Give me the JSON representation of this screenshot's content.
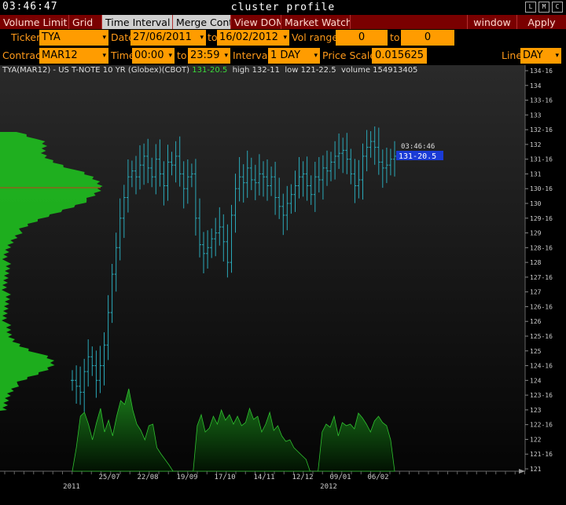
{
  "window": {
    "clock": "03:46:47",
    "title": "cluster profile",
    "buttons": [
      "L",
      "M",
      "C"
    ]
  },
  "menu": {
    "items": [
      "Volume Limit",
      "Grid",
      "Time Interval",
      "Merge Contr",
      "View DOM",
      "Market Watch"
    ],
    "right": [
      "window",
      "Apply"
    ]
  },
  "controls": {
    "ticker_label": "Ticker",
    "ticker": "TYA",
    "date_label": "Date",
    "date_from": "27/06/2011",
    "date_to_label": "to",
    "date_to": "16/02/2012",
    "vol_range_label": "Vol range",
    "vol_from": "0",
    "vol_to_label": "to",
    "vol_to": "0",
    "contract_label": "Contract",
    "contract": "MAR12",
    "time_label": "Time",
    "time_from": "00:00",
    "time_to_label": "to",
    "time_to": "23:59",
    "interval_label": "Interval",
    "interval": "1 DAY",
    "price_scale_label": "Price Scale",
    "price_scale": "0.015625",
    "line_label": "Line",
    "line": "DAY"
  },
  "chart_header": {
    "instrument": "TYA(MAR12) - US T-NOTE 10 YR (Globex)(CBOT)",
    "last": "131-20.5",
    "high": "high 132-11",
    "low": "low 121-22.5",
    "volume": "volume 154913405"
  },
  "overlay": {
    "time": "03:46:46",
    "price": "131-20.5"
  },
  "colors": {
    "candles": "#2aa8b8",
    "profile": "#1fbf1f",
    "volume": "#0c5a0c",
    "menu_bg": "#7a0000",
    "field_bg": "#ff9c00",
    "price_tag": "#1a3bd6"
  },
  "chart_data": {
    "type": "bar",
    "x_ticks": [
      "25/07",
      "22/08",
      "19/09",
      "17/10",
      "14/11",
      "12/12",
      "09/01",
      "06/02"
    ],
    "x_years": [
      "2011",
      "2012"
    ],
    "y_ticks": [
      "134-16",
      "134",
      "133-16",
      "133",
      "132-16",
      "132",
      "131-16",
      "131",
      "130-16",
      "130",
      "129-16",
      "129",
      "128-16",
      "128",
      "127-16",
      "127",
      "126-16",
      "126",
      "125-16",
      "125",
      "124-16",
      "124",
      "123-16",
      "123",
      "122-16",
      "122",
      "121-16",
      "121"
    ],
    "ylim": [
      121,
      134.5
    ],
    "daily_close": [
      124.0,
      123.8,
      123.6,
      124.3,
      124.8,
      124.5,
      124.0,
      124.5,
      125.2,
      126.3,
      127.6,
      128.5,
      129.5,
      130.2,
      130.9,
      131.1,
      130.9,
      131.3,
      131.6,
      131.2,
      130.9,
      131.5,
      131.0,
      130.6,
      131.4,
      131.3,
      131.6,
      131.0,
      130.5,
      130.9,
      131.0,
      129.5,
      128.6,
      128.3,
      128.5,
      128.8,
      129.0,
      129.2,
      128.7,
      128.0,
      129.6,
      130.5,
      130.9,
      130.7,
      131.2,
      130.8,
      130.7,
      131.0,
      130.9,
      130.6,
      130.9,
      130.2,
      129.9,
      129.6,
      130.0,
      130.3,
      130.6,
      130.9,
      131.0,
      130.6,
      130.3,
      130.9,
      130.8,
      131.2,
      131.1,
      131.4,
      131.6,
      131.7,
      131.8,
      131.5,
      131.0,
      130.6,
      130.8,
      131.6,
      131.9,
      132.1,
      131.9,
      131.4,
      131.2,
      131.3,
      131.5,
      131.6
    ]
  }
}
